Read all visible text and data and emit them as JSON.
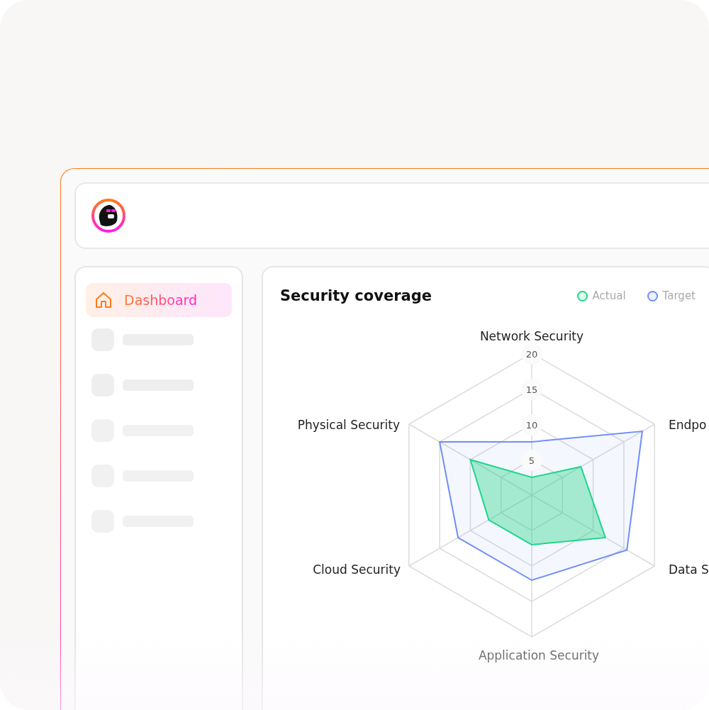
{
  "sidebar": {
    "items": [
      {
        "kind": "link",
        "label": "Dashboard",
        "selected": true
      },
      {
        "kind": "skeleton"
      },
      {
        "kind": "skeleton"
      },
      {
        "kind": "skeleton"
      },
      {
        "kind": "skeleton"
      },
      {
        "kind": "skeleton"
      }
    ]
  },
  "card": {
    "title": "Security coverage",
    "chart_data": {
      "type": "radar",
      "categories": [
        "Network Security",
        "Endpo",
        "Data S",
        "Application Security",
        "Cloud Security",
        "Physical Security"
      ],
      "ylim": [
        0,
        20
      ],
      "yticks": [
        5,
        10,
        15,
        20
      ],
      "series": [
        {
          "name": "Actual",
          "color": "#1fd68a",
          "values": [
            2.5,
            8,
            12,
            7,
            7,
            10
          ]
        },
        {
          "name": "Target",
          "color": "#6f8ff7",
          "values": [
            7.5,
            18,
            15.5,
            12,
            12,
            15
          ]
        }
      ]
    }
  }
}
